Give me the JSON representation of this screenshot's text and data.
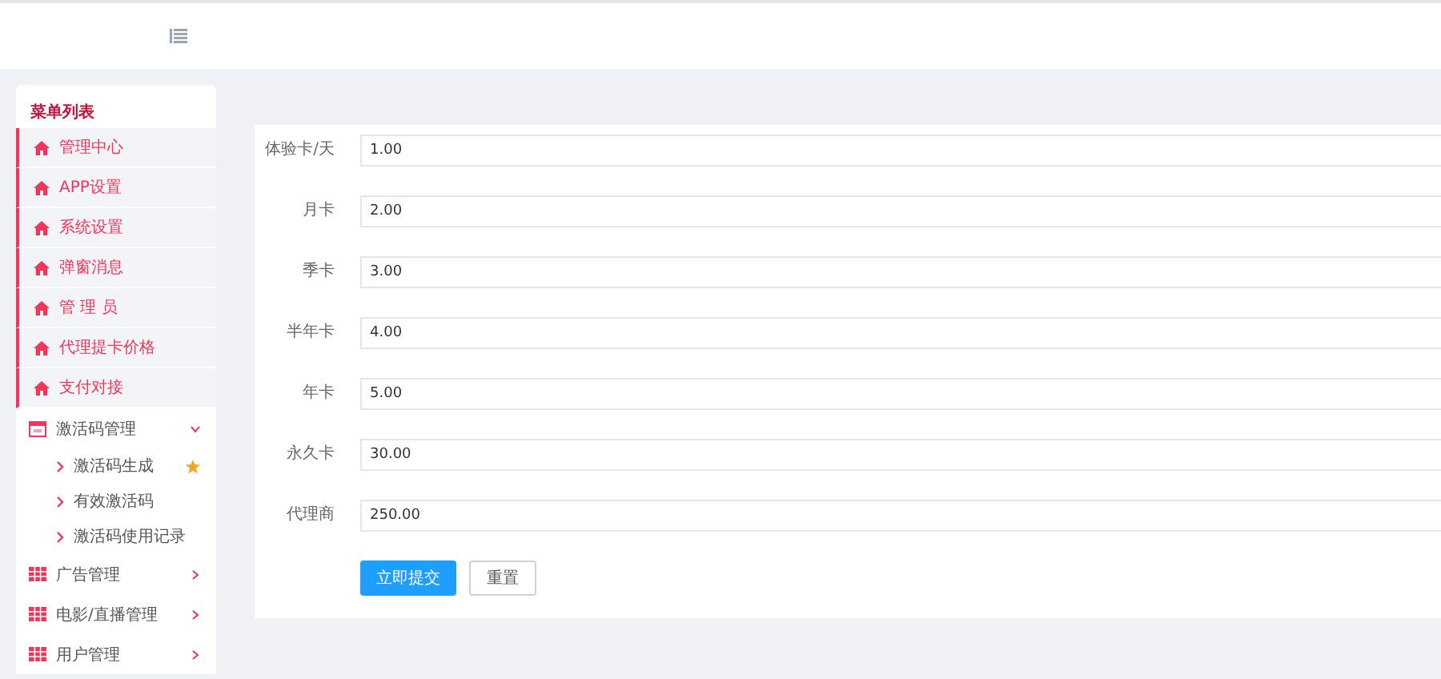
{
  "sidebar": {
    "title": "菜单列表",
    "items": [
      {
        "kind": "link",
        "label": "管理中心"
      },
      {
        "kind": "link",
        "label": "APP设置"
      },
      {
        "kind": "link",
        "label": "系统设置"
      },
      {
        "kind": "link",
        "label": "弹窗消息"
      },
      {
        "kind": "link",
        "label": "管 理 员"
      },
      {
        "kind": "link",
        "label": "代理提卡价格"
      },
      {
        "kind": "link",
        "label": "支付对接"
      },
      {
        "kind": "group",
        "label": "激活码管理",
        "expanded": true,
        "children": [
          {
            "label": "激活码生成",
            "starred": true
          },
          {
            "label": "有效激活码",
            "starred": false
          },
          {
            "label": "激活码使用记录",
            "starred": false
          }
        ]
      },
      {
        "kind": "group",
        "label": "广告管理",
        "expanded": false
      },
      {
        "kind": "group",
        "label": "电影/直播管理",
        "expanded": false
      },
      {
        "kind": "group",
        "label": "用户管理",
        "expanded": false
      }
    ]
  },
  "form": {
    "fields": [
      {
        "label": "体验卡/天",
        "value": "1.00"
      },
      {
        "label": "月卡",
        "value": "2.00"
      },
      {
        "label": "季卡",
        "value": "3.00"
      },
      {
        "label": "半年卡",
        "value": "4.00"
      },
      {
        "label": "年卡",
        "value": "5.00"
      },
      {
        "label": "永久卡",
        "value": "30.00"
      },
      {
        "label": "代理商",
        "value": "250.00"
      }
    ],
    "submit_button": "立即提交",
    "reset_button": "重置"
  }
}
